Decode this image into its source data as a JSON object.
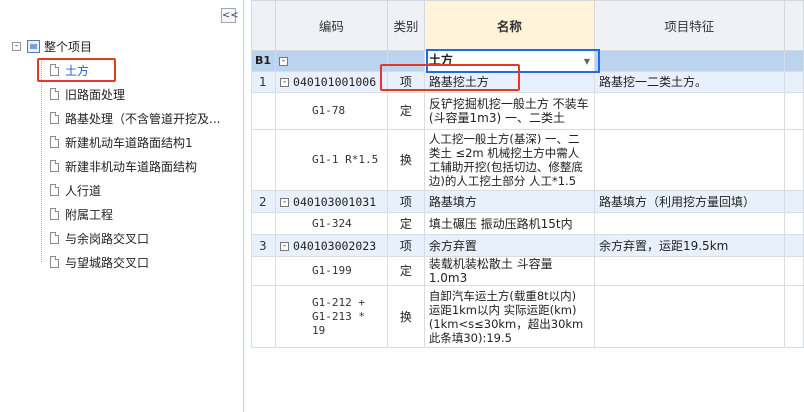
{
  "sidebar": {
    "collapse_label": "<<",
    "root_label": "整个项目",
    "root_expander": "-",
    "items": [
      {
        "label": "土方"
      },
      {
        "label": "旧路面处理"
      },
      {
        "label": "路基处理（不含管道开挖及..."
      },
      {
        "label": "新建机动车道路面结构1"
      },
      {
        "label": "新建非机动车道路面结构"
      },
      {
        "label": "人行道"
      },
      {
        "label": "附属工程"
      },
      {
        "label": "与余岗路交叉口"
      },
      {
        "label": "与望城路交叉口"
      }
    ]
  },
  "grid": {
    "headers": {
      "code": "编码",
      "category": "类别",
      "name": "名称",
      "feature": "项目特征"
    },
    "b1": {
      "rownum": "B1",
      "name": "土方"
    },
    "rows": [
      {
        "rownum": "1",
        "code": "040101001006",
        "category": "项",
        "name": "路基挖土方",
        "feature": "路基挖一二类土方。"
      },
      {
        "rownum": "",
        "code": "G1-78",
        "category": "定",
        "name": "反铲挖掘机挖一般土方 不装车(斗容量1m3) 一、二类土",
        "feature": ""
      },
      {
        "rownum": "",
        "code": "G1-1 R*1.5",
        "category": "换",
        "name": "人工挖一般土方(基深) 一、二类土 ≤2m 机械挖土方中需人工辅助开挖(包括切边、修整底边)的人工挖土部分 人工*1.5",
        "feature": ""
      },
      {
        "rownum": "2",
        "code": "040103001031",
        "category": "项",
        "name": "路基填方",
        "feature": "路基填方（利用挖方量回填）"
      },
      {
        "rownum": "",
        "code": "G1-324",
        "category": "定",
        "name": "填土碾压 振动压路机15t内",
        "feature": ""
      },
      {
        "rownum": "3",
        "code": "040103002023",
        "category": "项",
        "name": "余方弃置",
        "feature": "余方弃置，运距19.5km"
      },
      {
        "rownum": "",
        "code": "G1-199",
        "category": "定",
        "name": "装载机装松散土 斗容量1.0m3",
        "feature": ""
      },
      {
        "rownum": "",
        "code": "G1-212 + G1-213 * 19",
        "category": "换",
        "name": "自卸汽车运土方(载重8t以内) 运距1km以内 实际运距(km)(1km<s≤30km，超出30km此条填30):19.5",
        "feature": ""
      }
    ]
  }
}
